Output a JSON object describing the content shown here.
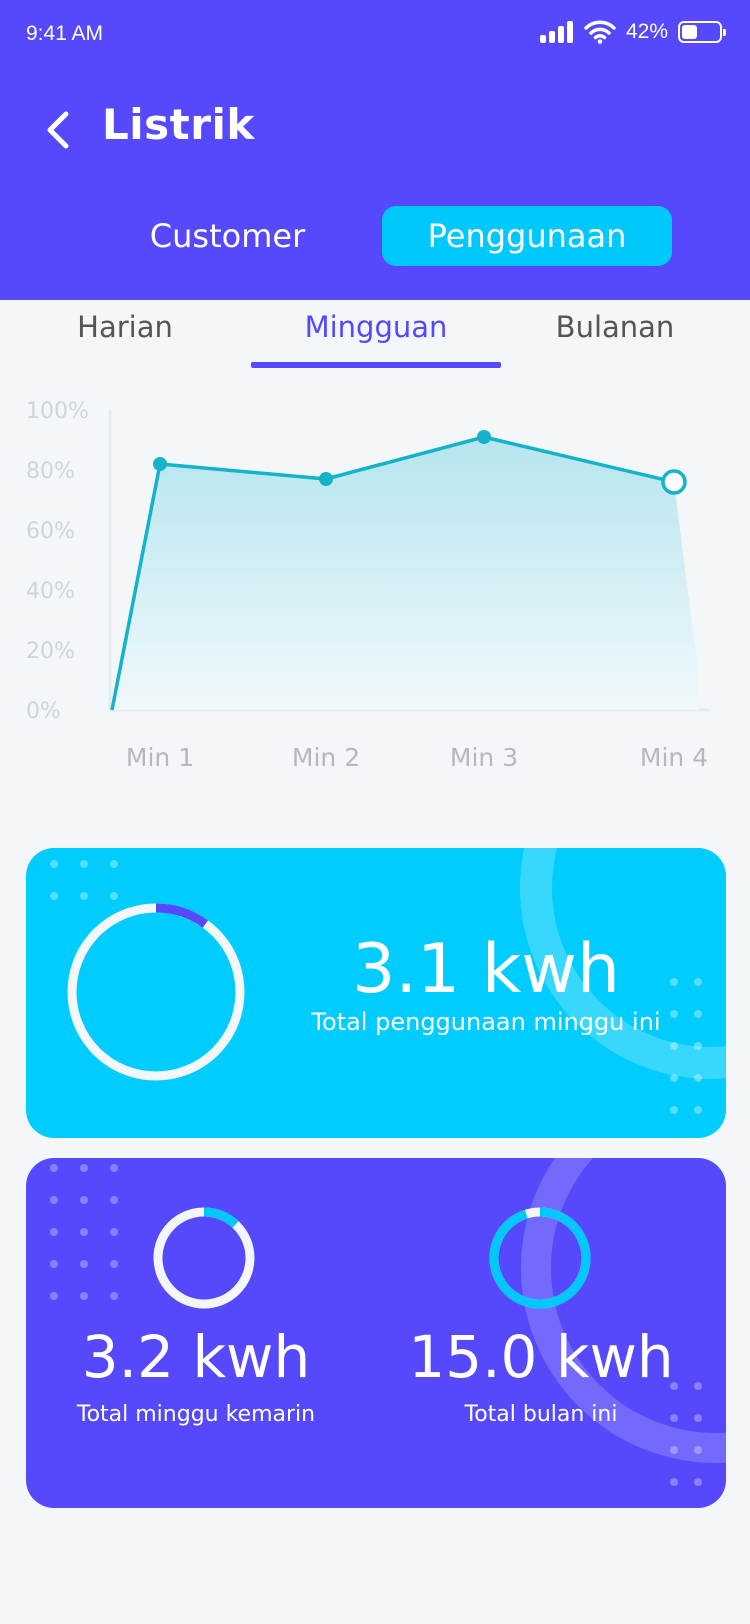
{
  "status_bar": {
    "time": "9:41 AM",
    "battery": "42%",
    "battery_level": 0.42
  },
  "header": {
    "title": "Listrik"
  },
  "segments": [
    {
      "label": "Customer",
      "active": false
    },
    {
      "label": "Penggunaan",
      "active": true
    }
  ],
  "tabs": [
    {
      "label": "Harian",
      "active": false
    },
    {
      "label": "Mingguan",
      "active": true
    },
    {
      "label": "Bulanan",
      "active": false
    }
  ],
  "chart_data": {
    "type": "area",
    "categories": [
      "Min 1",
      "Min 2",
      "Min 3",
      "Min 4"
    ],
    "y_ticks": [
      "100%",
      "80%",
      "60%",
      "40%",
      "20%",
      "0%"
    ],
    "values": [
      82,
      77,
      91,
      76
    ],
    "ylim": [
      0,
      100
    ],
    "grid": false
  },
  "summary_weekly": {
    "value": "3.1 kwh",
    "label": "Total penggunaan minggu ini",
    "ring_fraction": 0.1
  },
  "summary_last_week": {
    "value": "3.2 kwh",
    "label": "Total minggu kemarin",
    "ring_fraction": 0.12
  },
  "summary_month": {
    "value": "15.0 kwh",
    "label": "Total bulan ini",
    "ring_fraction": 0.95
  },
  "colors": {
    "primary": "#5549fb",
    "accent": "#00c8fb",
    "line": "#14b3c9",
    "background": "#f4f7fa"
  }
}
